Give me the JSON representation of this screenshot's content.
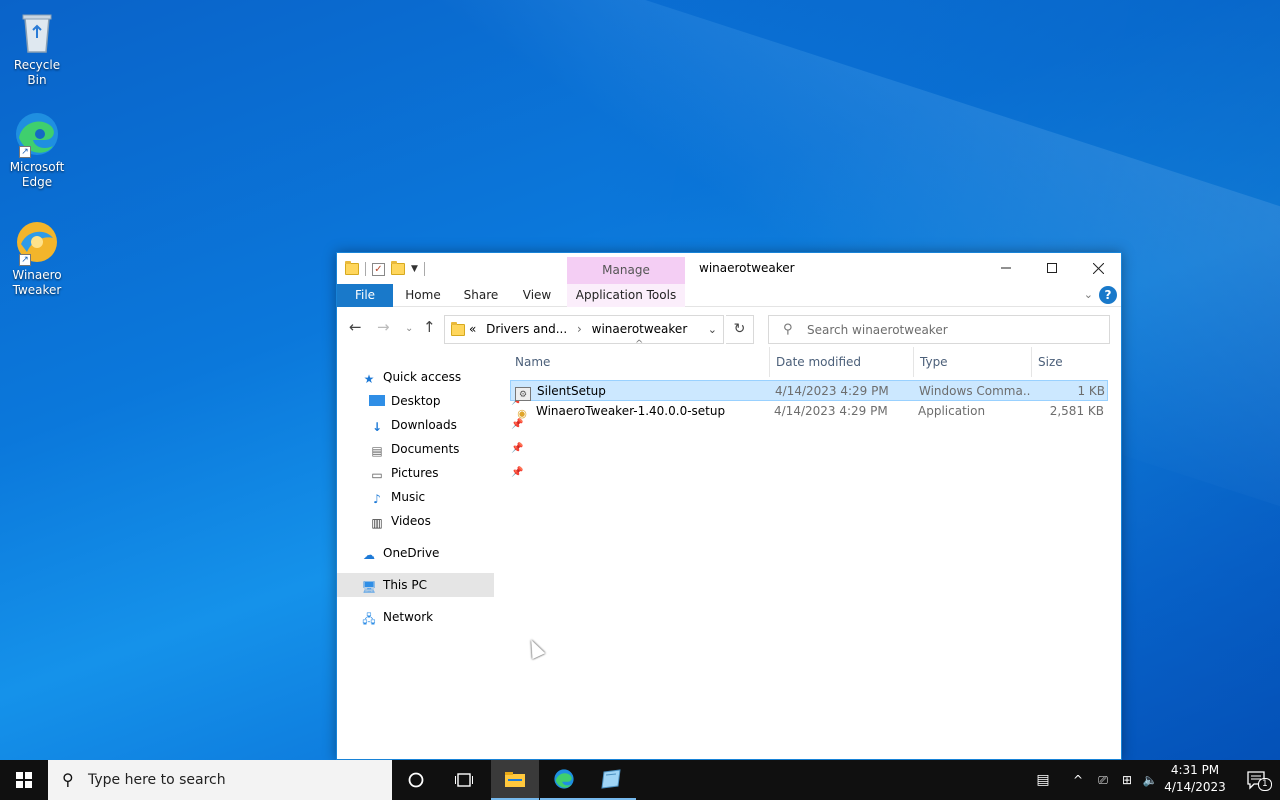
{
  "desktop": {
    "icons": [
      {
        "label": "Recycle Bin",
        "icon": "recycle-bin-icon"
      },
      {
        "label": "Microsoft Edge",
        "icon": "edge-icon"
      },
      {
        "label": "Winaero Tweaker",
        "icon": "winaero-tweaker-icon"
      }
    ]
  },
  "window": {
    "title": "winaerotweaker",
    "context_tab": "Manage",
    "ribbon_tabs": [
      "File",
      "Home",
      "Share",
      "View",
      "Application Tools"
    ],
    "address": {
      "overflow": "«",
      "segments": [
        "Drivers and...",
        "winaerotweaker"
      ]
    },
    "search_placeholder": "Search winaerotweaker",
    "nav": {
      "quick_access": "Quick access",
      "quick_items": [
        "Desktop",
        "Downloads",
        "Documents",
        "Pictures",
        "Music",
        "Videos"
      ],
      "onedrive": "OneDrive",
      "this_pc": "This PC",
      "network": "Network"
    },
    "columns": [
      "Name",
      "Date modified",
      "Type",
      "Size"
    ],
    "files": [
      {
        "name": "SilentSetup",
        "date": "4/14/2023 4:29 PM",
        "type": "Windows Comma...",
        "size": "1 KB",
        "selected": true
      },
      {
        "name": "WinaeroTweaker-1.40.0.0-setup",
        "date": "4/14/2023 4:29 PM",
        "type": "Application",
        "size": "2,581 KB",
        "selected": false
      }
    ]
  },
  "taskbar": {
    "search_placeholder": "Type here to search",
    "time": "4:31 PM",
    "date": "4/14/2023",
    "notification_count": "1"
  },
  "colors": {
    "accent": "#1979ca",
    "selection": "#cce8ff",
    "manage_tab": "#f4cef4"
  }
}
